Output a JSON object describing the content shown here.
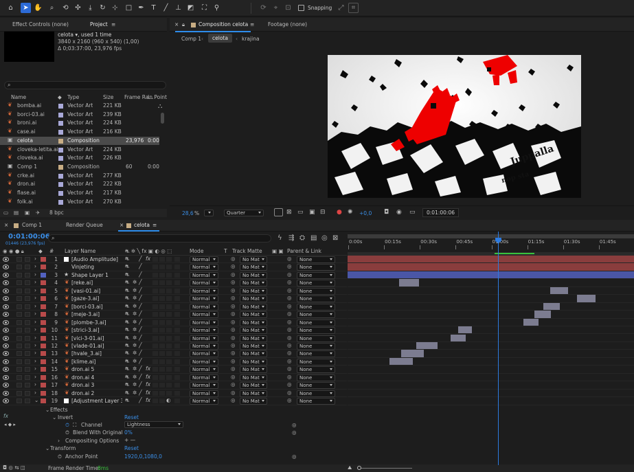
{
  "toolbar": {
    "tools": [
      "home-icon",
      "selection-tool-icon",
      "hand-tool-icon",
      "zoom-tool-icon",
      "orbit-camera-icon",
      "track-camera-icon",
      "dolly-camera-icon",
      "rotate-tool-icon",
      "pan-behind-icon",
      "rectangle-tool-icon",
      "pen-tool-icon",
      "type-tool-icon",
      "brush-tool-icon",
      "clone-stamp-icon",
      "eraser-icon",
      "roto-brush-icon",
      "puppet-pin-icon"
    ],
    "snapping_label": "Snapping"
  },
  "left_panel": {
    "tab_effect_controls": "Effect Controls (none)",
    "tab_project": "Project",
    "preview": {
      "name": "celota",
      "used": ", used 1 time",
      "resolution": "3840 x 2160  (960 x 540) (1,00)",
      "duration": "Δ 0;03:37:00, 23,976 fps"
    },
    "columns": {
      "name": "Name",
      "type": "Type",
      "size": "Size",
      "frame_rate": "Frame Ra...",
      "in_point": "In Point"
    },
    "items": [
      {
        "name": "bomba.ai",
        "type": "Vector Art",
        "size": "221 KB",
        "fps": "",
        "in": "",
        "color": "#a9a9d8"
      },
      {
        "name": "borci-03.ai",
        "type": "Vector Art",
        "size": "239 KB",
        "fps": "",
        "in": "",
        "color": "#a9a9d8"
      },
      {
        "name": "broni.ai",
        "type": "Vector Art",
        "size": "224 KB",
        "fps": "",
        "in": "",
        "color": "#a9a9d8"
      },
      {
        "name": "case.ai",
        "type": "Vector Art",
        "size": "216 KB",
        "fps": "",
        "in": "",
        "color": "#a9a9d8"
      },
      {
        "name": "celota",
        "type": "Composition",
        "size": "",
        "fps": "23,976",
        "in": "0:00",
        "color": "#c8ad84"
      },
      {
        "name": "cloveka-letita.ai",
        "type": "Vector Art",
        "size": "224 KB",
        "fps": "",
        "in": "",
        "color": "#a9a9d8"
      },
      {
        "name": "cloveka.ai",
        "type": "Vector Art",
        "size": "226 KB",
        "fps": "",
        "in": "",
        "color": "#a9a9d8"
      },
      {
        "name": "Comp 1",
        "type": "Composition",
        "size": "",
        "fps": "60",
        "in": "0:00",
        "color": "#c8ad84"
      },
      {
        "name": "crke.ai",
        "type": "Vector Art",
        "size": "277 KB",
        "fps": "",
        "in": "",
        "color": "#a9a9d8"
      },
      {
        "name": "dron.ai",
        "type": "Vector Art",
        "size": "222 KB",
        "fps": "",
        "in": "",
        "color": "#a9a9d8"
      },
      {
        "name": "flase.ai",
        "type": "Vector Art",
        "size": "217 KB",
        "fps": "",
        "in": "",
        "color": "#a9a9d8"
      },
      {
        "name": "folk.ai",
        "type": "Vector Art",
        "size": "270 KB",
        "fps": "",
        "in": "",
        "color": "#a9a9d8"
      }
    ],
    "bpc": "8 bpc"
  },
  "viewer": {
    "tab_composition": "Composition celota",
    "tab_footage": "Footage (none)",
    "breadcrumbs": [
      "Comp 1",
      "celota",
      "krajina"
    ],
    "zoom": "28,6",
    "zoom_unit": "%",
    "quality": "Quarter",
    "exposure": "+0,0",
    "timecode": "0:01:00:06"
  },
  "timeline": {
    "tabs": [
      "Comp 1",
      "Render Queue",
      "celota"
    ],
    "current_time": "0:01:00:06",
    "frame_info": "01446 (23,976 fps)",
    "search_placeholder": "",
    "headers": {
      "layer_name": "Layer Name",
      "mode": "Mode",
      "t": "T",
      "track_matte": "Track Matte",
      "parent": "Parent & Link"
    },
    "ruler": [
      "0:00s",
      "00:15s",
      "00:30s",
      "00:45s",
      "01:00s",
      "01:15s",
      "01:30s",
      "01:45s"
    ],
    "layers": [
      {
        "num": "1",
        "name": "[Audio Amplitude]",
        "color": "#b84a4a",
        "icon": "solid",
        "mode": "Normal",
        "matte": "No Mat",
        "parent": "None",
        "fx": true,
        "bar_start": 0,
        "bar_end": 2.0,
        "bar_color": "#8a3d3d"
      },
      {
        "num": "2",
        "name": "Vinjeting",
        "color": "#b84a4a",
        "icon": "none",
        "mode": "Normal",
        "matte": "No Mat",
        "parent": "None",
        "fx": false,
        "bar_start": 0,
        "bar_end": 2.0,
        "bar_color": "#8a3d3d"
      },
      {
        "num": "3",
        "name": "Shape Layer 1",
        "color": "#5262c0",
        "icon": "star",
        "mode": "Normal",
        "matte": "No Mat",
        "parent": "None",
        "fx": false,
        "bar_start": 0,
        "bar_end": 2.0,
        "bar_color": "#4a56a6"
      },
      {
        "num": "4",
        "name": "[reke.ai]",
        "color": "#b84a4a",
        "icon": "ai",
        "mode": "Normal",
        "matte": "No Mat",
        "parent": "None",
        "fx": false,
        "bar_start": 0.18,
        "bar_end": 0.25,
        "bar_color": "#7c7c90"
      },
      {
        "num": "5",
        "name": "[vasi-01.ai]",
        "color": "#b84a4a",
        "icon": "ai",
        "mode": "Normal",
        "matte": "No Mat",
        "parent": "None",
        "fx": false,
        "bar_start": 0.707,
        "bar_end": 0.77,
        "bar_color": "#7c7c90"
      },
      {
        "num": "6",
        "name": "[gaze-3.ai]",
        "color": "#b84a4a",
        "icon": "ai",
        "mode": "Normal",
        "matte": "No Mat",
        "parent": "None",
        "fx": false,
        "bar_start": 0.8,
        "bar_end": 0.865,
        "bar_color": "#7c7c90"
      },
      {
        "num": "7",
        "name": "[borci-03.ai]",
        "color": "#b84a4a",
        "icon": "ai",
        "mode": "Normal",
        "matte": "No Mat",
        "parent": "None",
        "fx": false,
        "bar_start": 0.683,
        "bar_end": 0.74,
        "bar_color": "#7c7c90"
      },
      {
        "num": "8",
        "name": "[meje-3.ai]",
        "color": "#b84a4a",
        "icon": "ai",
        "mode": "Normal",
        "matte": "No Mat",
        "parent": "None",
        "fx": false,
        "bar_start": 0.653,
        "bar_end": 0.71,
        "bar_color": "#7c7c90"
      },
      {
        "num": "9",
        "name": "[plombe-3.ai]",
        "color": "#b84a4a",
        "icon": "ai",
        "mode": "Normal",
        "matte": "No Mat",
        "parent": "None",
        "fx": false,
        "bar_start": 0.613,
        "bar_end": 0.667,
        "bar_color": "#7c7c90"
      },
      {
        "num": "10",
        "name": "[strici-3.ai]",
        "color": "#b84a4a",
        "icon": "ai",
        "mode": "Normal",
        "matte": "No Mat",
        "parent": "None",
        "fx": false,
        "bar_start": 0.387,
        "bar_end": 0.433,
        "bar_color": "#7c7c90"
      },
      {
        "num": "11",
        "name": "[vici-3-01.ai]",
        "color": "#b84a4a",
        "icon": "ai",
        "mode": "Normal",
        "matte": "No Mat",
        "parent": "None",
        "fx": false,
        "bar_start": 0.36,
        "bar_end": 0.413,
        "bar_color": "#7c7c90"
      },
      {
        "num": "12",
        "name": "[vlade-01.ai]",
        "color": "#b84a4a",
        "icon": "ai",
        "mode": "Normal",
        "matte": "No Mat",
        "parent": "None",
        "fx": false,
        "bar_start": 0.24,
        "bar_end": 0.313,
        "bar_color": "#7c7c90"
      },
      {
        "num": "13",
        "name": "[hvale_3.ai]",
        "color": "#b84a4a",
        "icon": "ai",
        "mode": "Normal",
        "matte": "No Mat",
        "parent": "None",
        "fx": false,
        "bar_start": 0.187,
        "bar_end": 0.267,
        "bar_color": "#7c7c90"
      },
      {
        "num": "14",
        "name": "[klime.ai]",
        "color": "#b84a4a",
        "icon": "ai",
        "mode": "Normal",
        "matte": "No Mat",
        "parent": "None",
        "fx": false,
        "bar_start": 0.147,
        "bar_end": 0.227,
        "bar_color": "#7c7c90"
      },
      {
        "num": "15",
        "name": "dron.ai 5",
        "color": "#b84a4a",
        "icon": "ai",
        "mode": "Normal",
        "matte": "No Mat",
        "parent": "None",
        "fx": true,
        "bar_start": null,
        "bar_end": null,
        "bar_color": ""
      },
      {
        "num": "16",
        "name": "dron.ai 4",
        "color": "#b84a4a",
        "icon": "ai",
        "mode": "Normal",
        "matte": "No Mat",
        "parent": "None",
        "fx": true,
        "bar_start": null,
        "bar_end": null,
        "bar_color": ""
      },
      {
        "num": "17",
        "name": "dron.ai 3",
        "color": "#b84a4a",
        "icon": "ai",
        "mode": "Normal",
        "matte": "No Mat",
        "parent": "None",
        "fx": true,
        "bar_start": null,
        "bar_end": null,
        "bar_color": ""
      },
      {
        "num": "18",
        "name": "dron.ai 2",
        "color": "#b84a4a",
        "icon": "ai",
        "mode": "Normal",
        "matte": "No Mat",
        "parent": "None",
        "fx": true,
        "bar_start": null,
        "bar_end": null,
        "bar_color": ""
      },
      {
        "num": "19",
        "name": "[Adjustment Layer 3]",
        "color": "#b84a4a",
        "icon": "solid",
        "mode": "Normal",
        "matte": "No Mat",
        "parent": "None",
        "fx": true,
        "bar_start": null,
        "bar_end": null,
        "bar_color": ""
      }
    ],
    "effects": {
      "effects_label": "Effects",
      "invert_label": "Invert",
      "reset": "Reset",
      "channel_label": "Channel",
      "channel_value": "Lightness",
      "blend_label": "Blend With Original",
      "blend_value": "0%",
      "compositing_label": "Compositing Options",
      "compositing_value": "+ —",
      "transform_label": "Transform",
      "transform_reset": "Reset",
      "anchor_label": "Anchor Point",
      "anchor_value": "1920,0,1080,0"
    },
    "render_time_label": "Frame Render Time:",
    "render_time_value": "8ms",
    "playhead_fraction": 0.525
  }
}
